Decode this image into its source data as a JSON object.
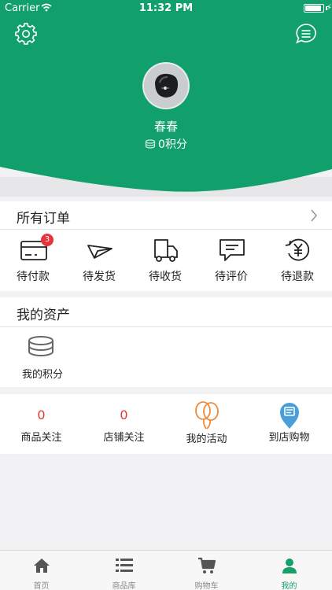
{
  "status_bar": {
    "carrier": "Carrier",
    "time": "11:32 PM",
    "battery_level": 0.92
  },
  "profile": {
    "name": "春春",
    "points": "0积分"
  },
  "orders": {
    "title": "所有订单",
    "items": [
      {
        "label": "待付款",
        "icon": "wallet-card-icon",
        "badge": "3"
      },
      {
        "label": "待发货",
        "icon": "paper-plane-icon"
      },
      {
        "label": "待收货",
        "icon": "delivery-truck-icon"
      },
      {
        "label": "待评价",
        "icon": "comment-icon"
      },
      {
        "label": "待退款",
        "icon": "refund-yen-icon"
      }
    ]
  },
  "assets": {
    "title": "我的资产",
    "items": [
      {
        "label": "我的积分",
        "icon": "coin-stack-icon"
      }
    ]
  },
  "follows": {
    "items": [
      {
        "count": "0",
        "label": "商品关注"
      },
      {
        "count": "0",
        "label": "店铺关注"
      },
      {
        "label": "我的活动",
        "icon": "balloons-icon"
      },
      {
        "label": "到店购物",
        "icon": "store-pin-icon"
      }
    ]
  },
  "tabbar": {
    "items": [
      {
        "label": "首页",
        "icon": "home-icon"
      },
      {
        "label": "商品库",
        "icon": "list-icon"
      },
      {
        "label": "购物车",
        "icon": "cart-icon"
      },
      {
        "label": "我的",
        "icon": "user-icon"
      }
    ],
    "active_index": 3
  },
  "colors": {
    "brand_green": "#11a06b",
    "badge_red": "#e5343a",
    "count_red": "#e03a2f",
    "activity_orange": "#f08a3e",
    "store_blue": "#4b9fd9"
  }
}
